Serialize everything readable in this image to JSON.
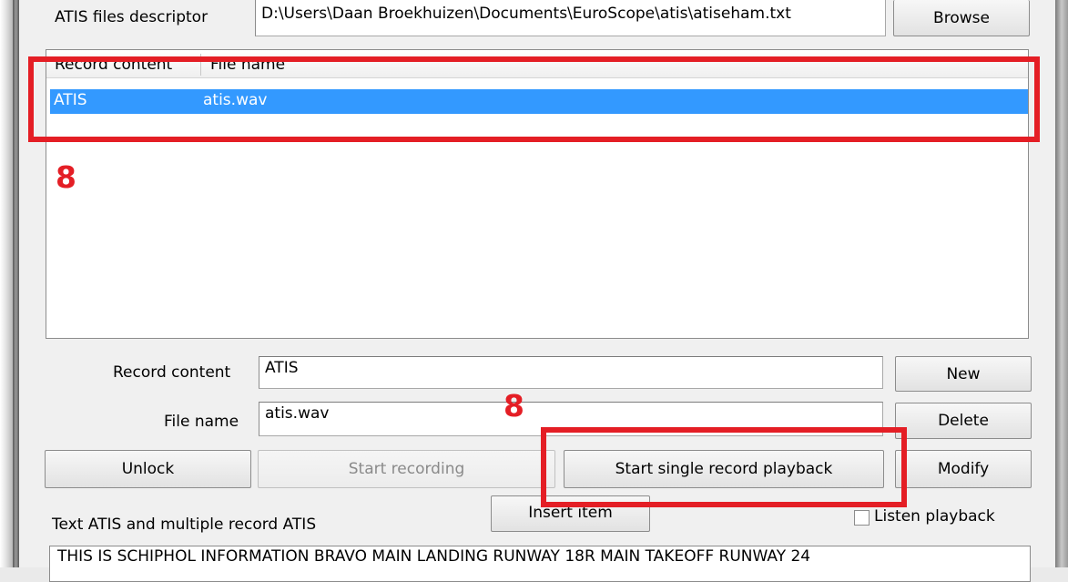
{
  "descriptor": {
    "label": "ATIS files descriptor",
    "path": "D:\\Users\\Daan Broekhuizen\\Documents\\EuroScope\\atis\\atiseham.txt",
    "browse_label": "Browse"
  },
  "list": {
    "columns": [
      "Record content",
      "File name"
    ],
    "rows": [
      {
        "record": "ATIS",
        "file": "atis.wav"
      }
    ]
  },
  "form": {
    "record_content_label": "Record content",
    "record_content_value": "ATIS",
    "file_name_label": "File name",
    "file_name_value": "atis.wav"
  },
  "buttons": {
    "new": "New",
    "delete": "Delete",
    "modify": "Modify",
    "unlock": "Unlock",
    "start_recording": "Start recording",
    "start_single_playback": "Start single record playback",
    "insert_item": "Insert item"
  },
  "text_atis": {
    "label": "Text ATIS and multiple record ATIS",
    "listen_playback_label": "Listen playback",
    "listen_playback_checked": false,
    "content": "THIS IS SCHIPHOL INFORMATION BRAVO MAIN LANDING RUNWAY 18R MAIN TAKEOFF RUNWAY 24"
  },
  "annotations": {
    "list_marker": "8",
    "button_marker": "8",
    "color": "#e41e25"
  }
}
